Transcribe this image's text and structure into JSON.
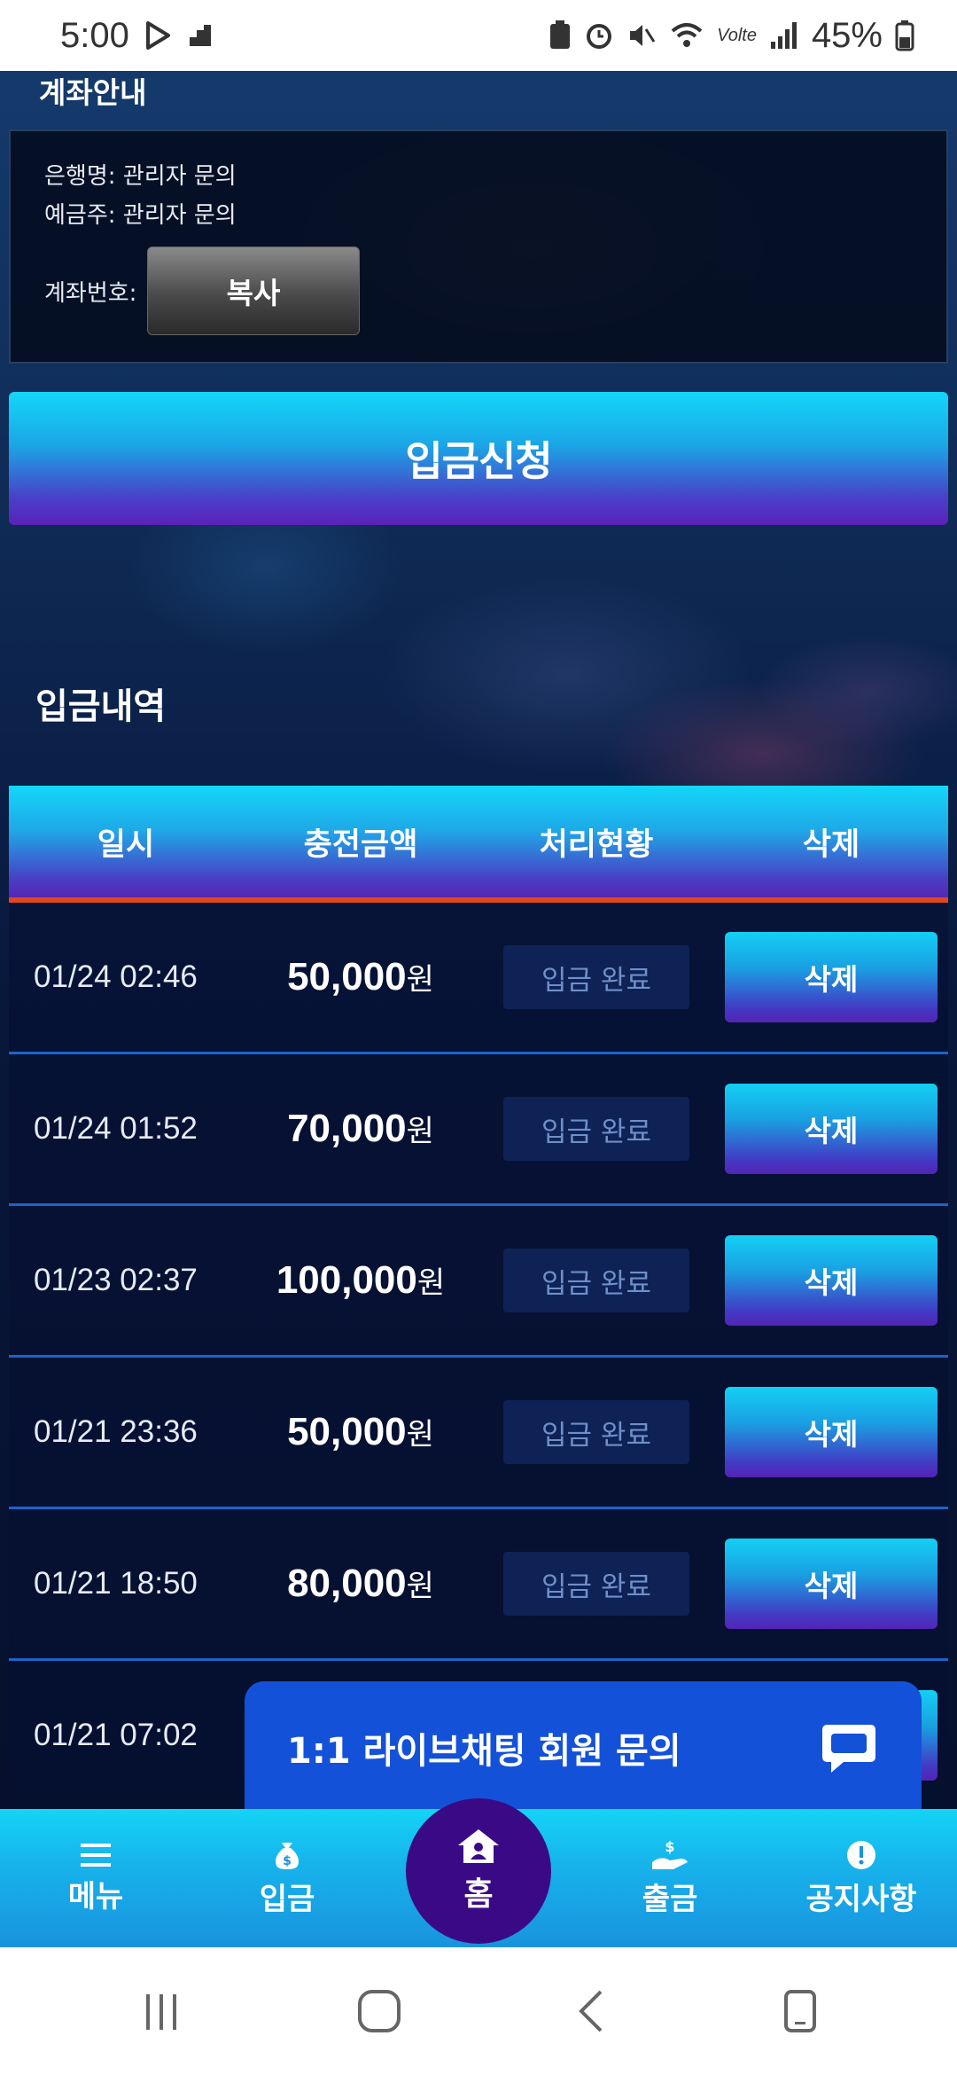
{
  "status_bar": {
    "time": "5:00",
    "network": "Volte",
    "battery": "45%"
  },
  "account_info": {
    "title": "계좌안내",
    "bank_label": "은행명: 관리자 문의",
    "holder_label": "예금주: 관리자 문의",
    "number_label": "계좌번호:",
    "copy_button": "복사"
  },
  "apply_button": "입금신청",
  "history": {
    "title": "입금내역",
    "headers": [
      "일시",
      "충전금액",
      "처리현황",
      "삭제"
    ],
    "currency_suffix": "원",
    "rows": [
      {
        "date": "01/24 02:46",
        "amount": "50,000",
        "status": "입금 완료",
        "delete": "삭제"
      },
      {
        "date": "01/24 01:52",
        "amount": "70,000",
        "status": "입금 완료",
        "delete": "삭제"
      },
      {
        "date": "01/23 02:37",
        "amount": "100,000",
        "status": "입금 완료",
        "delete": "삭제"
      },
      {
        "date": "01/21 23:36",
        "amount": "50,000",
        "status": "입금 완료",
        "delete": "삭제"
      },
      {
        "date": "01/21 18:50",
        "amount": "80,000",
        "status": "입금 완료",
        "delete": "삭제"
      },
      {
        "date": "01/21 07:02",
        "amount": "",
        "status": "",
        "delete": ""
      }
    ]
  },
  "live_chat": {
    "label": "1:1 라이브채팅 회원 문의"
  },
  "bottom_nav": {
    "menu": "메뉴",
    "deposit": "입금",
    "home": "홈",
    "withdraw": "출금",
    "notice": "공지사항"
  },
  "colors": {
    "accent_cyan": "#13d7f8",
    "accent_purple": "#5a22b8",
    "header_underline": "#e3461c",
    "chat_blue": "#1351d8",
    "home_circle": "#3a0a86"
  }
}
